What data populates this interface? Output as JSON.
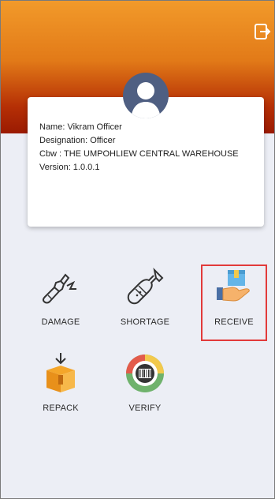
{
  "header": {
    "logout_icon": "logout-icon"
  },
  "profile": {
    "avatar_icon": "user-avatar-icon",
    "name": "Name: Vikram Officer",
    "designation": "Designation: Officer",
    "cbw": "Cbw : THE UMPOHLIEW CENTRAL WAREHOUSE",
    "version": "Version: 1.0.0.1"
  },
  "actions": [
    {
      "label": "DAMAGE",
      "icon": "broken-bottle-icon"
    },
    {
      "label": "SHORTAGE",
      "icon": "bottle-icon"
    },
    {
      "label": "RECEIVE",
      "icon": "hand-box-icon",
      "highlighted": true
    },
    {
      "label": "REPACK",
      "icon": "box-down-arrow-icon"
    },
    {
      "label": "VERIFY",
      "icon": "barcode-badge-icon"
    }
  ],
  "colors": {
    "header_top": "#f29a2a",
    "header_bottom": "#9a1a02",
    "highlight": "#e23a3a",
    "background": "#eceef5"
  }
}
